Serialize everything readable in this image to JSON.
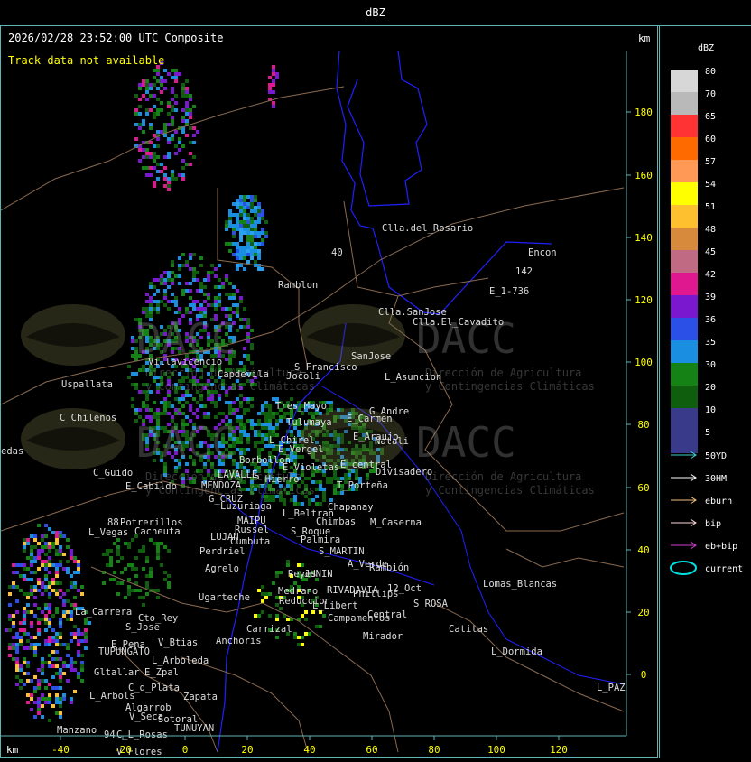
{
  "window_title": "dBZ",
  "header": {
    "timestamp": "2026/02/28 23:52:00 UTC Composite",
    "track_status": "Track data not available",
    "y_unit": "km",
    "x_unit": "km"
  },
  "axes": {
    "x_ticks": [
      "-40",
      "-20",
      "0",
      "20",
      "40",
      "60",
      "80",
      "100",
      "120"
    ],
    "y_ticks": [
      "180",
      "160",
      "140",
      "120",
      "100",
      "80",
      "60",
      "40",
      "20",
      "0"
    ]
  },
  "watermark": {
    "brand": "DACC",
    "line1": "Dirección de Agricultura",
    "line2": "y Contingencias Climáticas"
  },
  "places": [
    {
      "name": "Clla.del_Rosario"
    },
    {
      "name": "Encon"
    },
    {
      "name": "142"
    },
    {
      "name": "E_1-736"
    },
    {
      "name": "Ramblon"
    },
    {
      "name": "Clla.SanJose"
    },
    {
      "name": "Clla.El_Cavadito"
    },
    {
      "name": "Villavicencio"
    },
    {
      "name": "Uspallata"
    },
    {
      "name": "Capdevila"
    },
    {
      "name": "Jocoli"
    },
    {
      "name": "S_Francisco"
    },
    {
      "name": "SanJose"
    },
    {
      "name": "L_Asuncion"
    },
    {
      "name": "C_Chilenos"
    },
    {
      "name": "Tres_Mayo"
    },
    {
      "name": "G_Andre"
    },
    {
      "name": "Tulumaya"
    },
    {
      "name": "E_Carmen"
    },
    {
      "name": "edas"
    },
    {
      "name": "E_Araujo"
    },
    {
      "name": "L_Chirel"
    },
    {
      "name": "Natali"
    },
    {
      "name": "E_Vergel"
    },
    {
      "name": "Borbollon"
    },
    {
      "name": "E_Violetas"
    },
    {
      "name": "E_central"
    },
    {
      "name": "C_Guido"
    },
    {
      "name": "LAVALLE"
    },
    {
      "name": "Divisadero"
    },
    {
      "name": "P_Hierro"
    },
    {
      "name": "E_Cabildo"
    },
    {
      "name": "MENDOZA"
    },
    {
      "name": "T_Porteña"
    },
    {
      "name": "G_CRUZ"
    },
    {
      "name": "Luzuriaga"
    },
    {
      "name": "L_Beltran"
    },
    {
      "name": "Chapanay"
    },
    {
      "name": "Potrerillos"
    },
    {
      "name": "MAIPU"
    },
    {
      "name": "Chimbas"
    },
    {
      "name": "M_Caserna"
    },
    {
      "name": "L_Vegas"
    },
    {
      "name": "Cacheuta"
    },
    {
      "name": "Russel"
    },
    {
      "name": "S_Roque"
    },
    {
      "name": "LUJAN"
    },
    {
      "name": "Cumbuta"
    },
    {
      "name": "Palmira"
    },
    {
      "name": "Perdriel"
    },
    {
      "name": "S_MARTIN"
    },
    {
      "name": "Agrelo"
    },
    {
      "name": "A_Verde"
    },
    {
      "name": "Reyes"
    },
    {
      "name": "JUNIN"
    },
    {
      "name": "Rambión"
    },
    {
      "name": "Ugarteche"
    },
    {
      "name": "RIVADAVIA"
    },
    {
      "name": "Phillips"
    },
    {
      "name": "Lomas_Blancas"
    },
    {
      "name": "12_Oct"
    },
    {
      "name": "Medrano"
    },
    {
      "name": "Reduccion"
    },
    {
      "name": "L_Libert"
    },
    {
      "name": "S_ROSA"
    },
    {
      "name": "La_Carrera"
    },
    {
      "name": "Cto_Rey"
    },
    {
      "name": "S_Jose"
    },
    {
      "name": "Campamentos"
    },
    {
      "name": "Central"
    },
    {
      "name": "Carrizal"
    },
    {
      "name": "Catitas"
    },
    {
      "name": "Anchoris"
    },
    {
      "name": "Mirador"
    },
    {
      "name": "E_Pena"
    },
    {
      "name": "V_Btias"
    },
    {
      "name": "TUPUNGATO"
    },
    {
      "name": "L_Dormida"
    },
    {
      "name": "L_Arboleda"
    },
    {
      "name": "Gltallar"
    },
    {
      "name": "E_Zpal"
    },
    {
      "name": "C_d_Plata"
    },
    {
      "name": "L_Arbols"
    },
    {
      "name": "Zapata"
    },
    {
      "name": "L_PAZ"
    },
    {
      "name": "Algarrob"
    },
    {
      "name": "Sotoral"
    },
    {
      "name": "V_Seca"
    },
    {
      "name": "TUNUYAN"
    },
    {
      "name": "Manzano"
    },
    {
      "name": "C_L_Rosas"
    },
    {
      "name": "94"
    },
    {
      "name": "V_Flores"
    },
    {
      "name": "40"
    },
    {
      "name": "88"
    }
  ],
  "legend": {
    "title": "dBZ",
    "scale": [
      {
        "label": "80",
        "color": "#d7d7d7"
      },
      {
        "label": "70",
        "color": "#b9b9b9"
      },
      {
        "label": "65",
        "color": "#ff3333"
      },
      {
        "label": "60",
        "color": "#ff6a00"
      },
      {
        "label": "57",
        "color": "#ff9955"
      },
      {
        "label": "54",
        "color": "#ffff00"
      },
      {
        "label": "51",
        "color": "#ffc030"
      },
      {
        "label": "48",
        "color": "#d88a3c"
      },
      {
        "label": "45",
        "color": "#c06a84"
      },
      {
        "label": "42",
        "color": "#e01890"
      },
      {
        "label": "39",
        "color": "#7a18d0"
      },
      {
        "label": "36",
        "color": "#2a50e8"
      },
      {
        "label": "35",
        "color": "#1a8ee0"
      },
      {
        "label": "30",
        "color": "#148214"
      },
      {
        "label": "20",
        "color": "#0e5e0e"
      },
      {
        "label": "10",
        "color": "#3a3a8a"
      },
      {
        "label": "5",
        "color": "#3a3a8a"
      }
    ],
    "tracks": [
      {
        "label": "50YD",
        "color": "#3fd0d0"
      },
      {
        "label": "30HM",
        "color": "#ffffff"
      },
      {
        "label": "eburn",
        "color": "#f0c080"
      },
      {
        "label": "bip",
        "color": "#ffd8d8"
      },
      {
        "label": "eb+bip",
        "color": "#d040d0"
      },
      {
        "label": "current",
        "color": "#00e0e0"
      }
    ]
  },
  "colors": {
    "frame": "#5fb4b4",
    "tick_label": "#ffff00",
    "boundary_province": "#2020ff",
    "boundary_dept": "#8a6a50"
  }
}
